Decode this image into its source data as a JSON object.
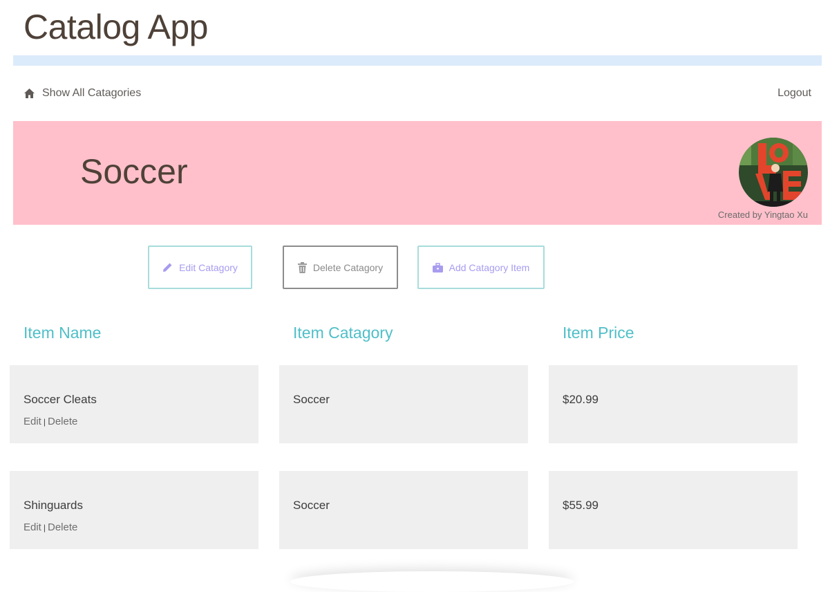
{
  "app": {
    "title": "Catalog App"
  },
  "nav": {
    "home_label": "Show All Catagories",
    "logout_label": "Logout"
  },
  "banner": {
    "title": "Soccer",
    "created_by": "Created by Yingtao Xu",
    "background": "#ffc0cb"
  },
  "actions": {
    "edit_label": "Edit Catagory",
    "delete_label": "Delete Catagory",
    "add_label": "Add Catagory Item"
  },
  "table": {
    "headers": [
      "Item Name",
      "Item Catagory",
      "Item Price"
    ],
    "rows": [
      {
        "name": "Soccer Cleats",
        "category": "Soccer",
        "price": "$20.99",
        "edit": "Edit",
        "sep": "|",
        "delete": "Delete"
      },
      {
        "name": "Shinguards",
        "category": "Soccer",
        "price": "$55.99",
        "edit": "Edit",
        "sep": "|",
        "delete": "Delete"
      }
    ]
  },
  "icons": {
    "home": "home-icon",
    "edit": "pencil-icon",
    "delete": "trash-icon",
    "add": "briefcase-icon"
  },
  "colors": {
    "accent": "#4fbfc8",
    "button_text": "#a79cf0",
    "title_bar": "#dcebfb",
    "cell_bg": "#efefef"
  }
}
